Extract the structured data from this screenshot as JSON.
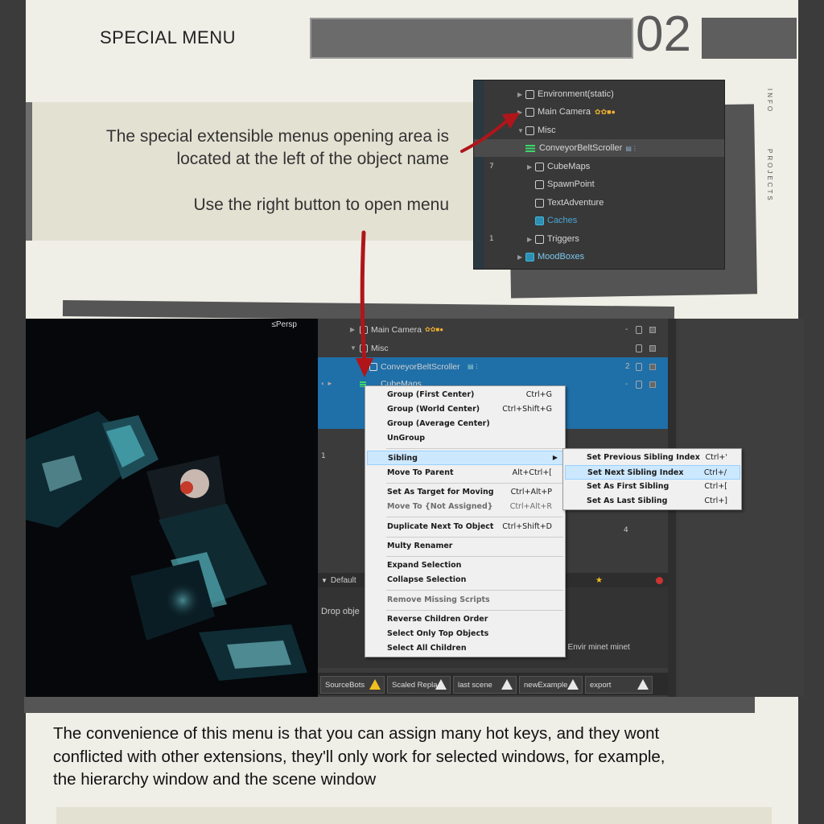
{
  "page": {
    "title": "SPECIAL MENU",
    "number": "02",
    "side_tabs": [
      "INFO",
      "PROJECTS"
    ],
    "instructions": [
      "The special extensible menus opening area is",
      "located at the left of the object name",
      "Use the right button to open menu"
    ],
    "footer_text": [
      "The convenience of this menu is that you can assign many hot keys, and they wont",
      "conflicted with other extensions, they'll only work for selected windows, for example,",
      "the hierarchy window and the scene window"
    ]
  },
  "top_hierarchy": {
    "left_numbers": [
      "7",
      "1"
    ],
    "items": [
      {
        "label": "Environment(static)",
        "icon": "cube-icon"
      },
      {
        "label": "Main Camera",
        "icon": "cube-icon"
      },
      {
        "label": "Misc",
        "icon": "cube-icon"
      },
      {
        "label": "ConveyorBeltScroller",
        "icon": "lines-icon"
      },
      {
        "label": "CubeMaps",
        "icon": "cube-icon"
      },
      {
        "label": "SpawnPoint",
        "icon": "cube-icon"
      },
      {
        "label": "TextAdventure",
        "icon": "cube-icon"
      },
      {
        "label": "Caches",
        "icon": "blue-cube-icon"
      },
      {
        "label": "Triggers",
        "icon": "cube-icon"
      },
      {
        "label": "MoodBoxes",
        "icon": "blue-cube-icon"
      }
    ]
  },
  "scene_view": {
    "label": "≤Persp"
  },
  "hierarchy": {
    "rows": [
      {
        "label": "Main Camera",
        "dash": "-"
      },
      {
        "label": "Misc",
        "dash": ""
      },
      {
        "label": "ConveyorBeltScroller",
        "dash": "2"
      },
      {
        "label": "CubeMaps",
        "dash": "-"
      }
    ],
    "right_numbers": [
      "1",
      "4"
    ],
    "toolbar_label": "Default",
    "drop_text": "Drop obje",
    "breadcrumb": "el  Envir  minet  minet",
    "scene_tabs": [
      "SourceBots",
      "Scaled Repla",
      "last scene",
      "newExample",
      "export"
    ]
  },
  "context_menu": {
    "groups": [
      [
        {
          "label": "Group (First Center)",
          "shortcut": "Ctrl+G"
        },
        {
          "label": "Group (World Center)",
          "shortcut": "Ctrl+Shift+G"
        },
        {
          "label": "Group (Average Center)",
          "shortcut": ""
        },
        {
          "label": "UnGroup",
          "shortcut": ""
        }
      ],
      [
        {
          "label": "Sibling",
          "shortcut": "",
          "submenu": true,
          "highlighted": true
        },
        {
          "label": "Move To Parent",
          "shortcut": "Alt+Ctrl+["
        }
      ],
      [
        {
          "label": "Set As Target for Moving",
          "shortcut": "Ctrl+Alt+P"
        },
        {
          "label": "Move To {Not Assigned}",
          "shortcut": "Ctrl+Alt+R",
          "disabled": true
        }
      ],
      [
        {
          "label": "Duplicate Next To Object",
          "shortcut": "Ctrl+Shift+D"
        }
      ],
      [
        {
          "label": "Multy Renamer",
          "shortcut": ""
        }
      ],
      [
        {
          "label": "Expand Selection",
          "shortcut": ""
        },
        {
          "label": "Collapse Selection",
          "shortcut": ""
        }
      ],
      [
        {
          "label": "Remove Missing Scripts",
          "shortcut": "",
          "disabled": true
        }
      ],
      [
        {
          "label": "Reverse Children Order",
          "shortcut": ""
        },
        {
          "label": "Select Only Top Objects",
          "shortcut": ""
        },
        {
          "label": "Select All Children",
          "shortcut": ""
        }
      ]
    ]
  },
  "sibling_submenu": {
    "items": [
      {
        "label": "Set Previous Sibling Index",
        "shortcut": "Ctrl+'"
      },
      {
        "label": "Set Next Sibling Index",
        "shortcut": "Ctrl+/",
        "highlighted": true
      },
      {
        "label": "Set As First Sibling",
        "shortcut": "Ctrl+["
      },
      {
        "label": "Set As Last Sibling",
        "shortcut": "Ctrl+]"
      }
    ]
  }
}
